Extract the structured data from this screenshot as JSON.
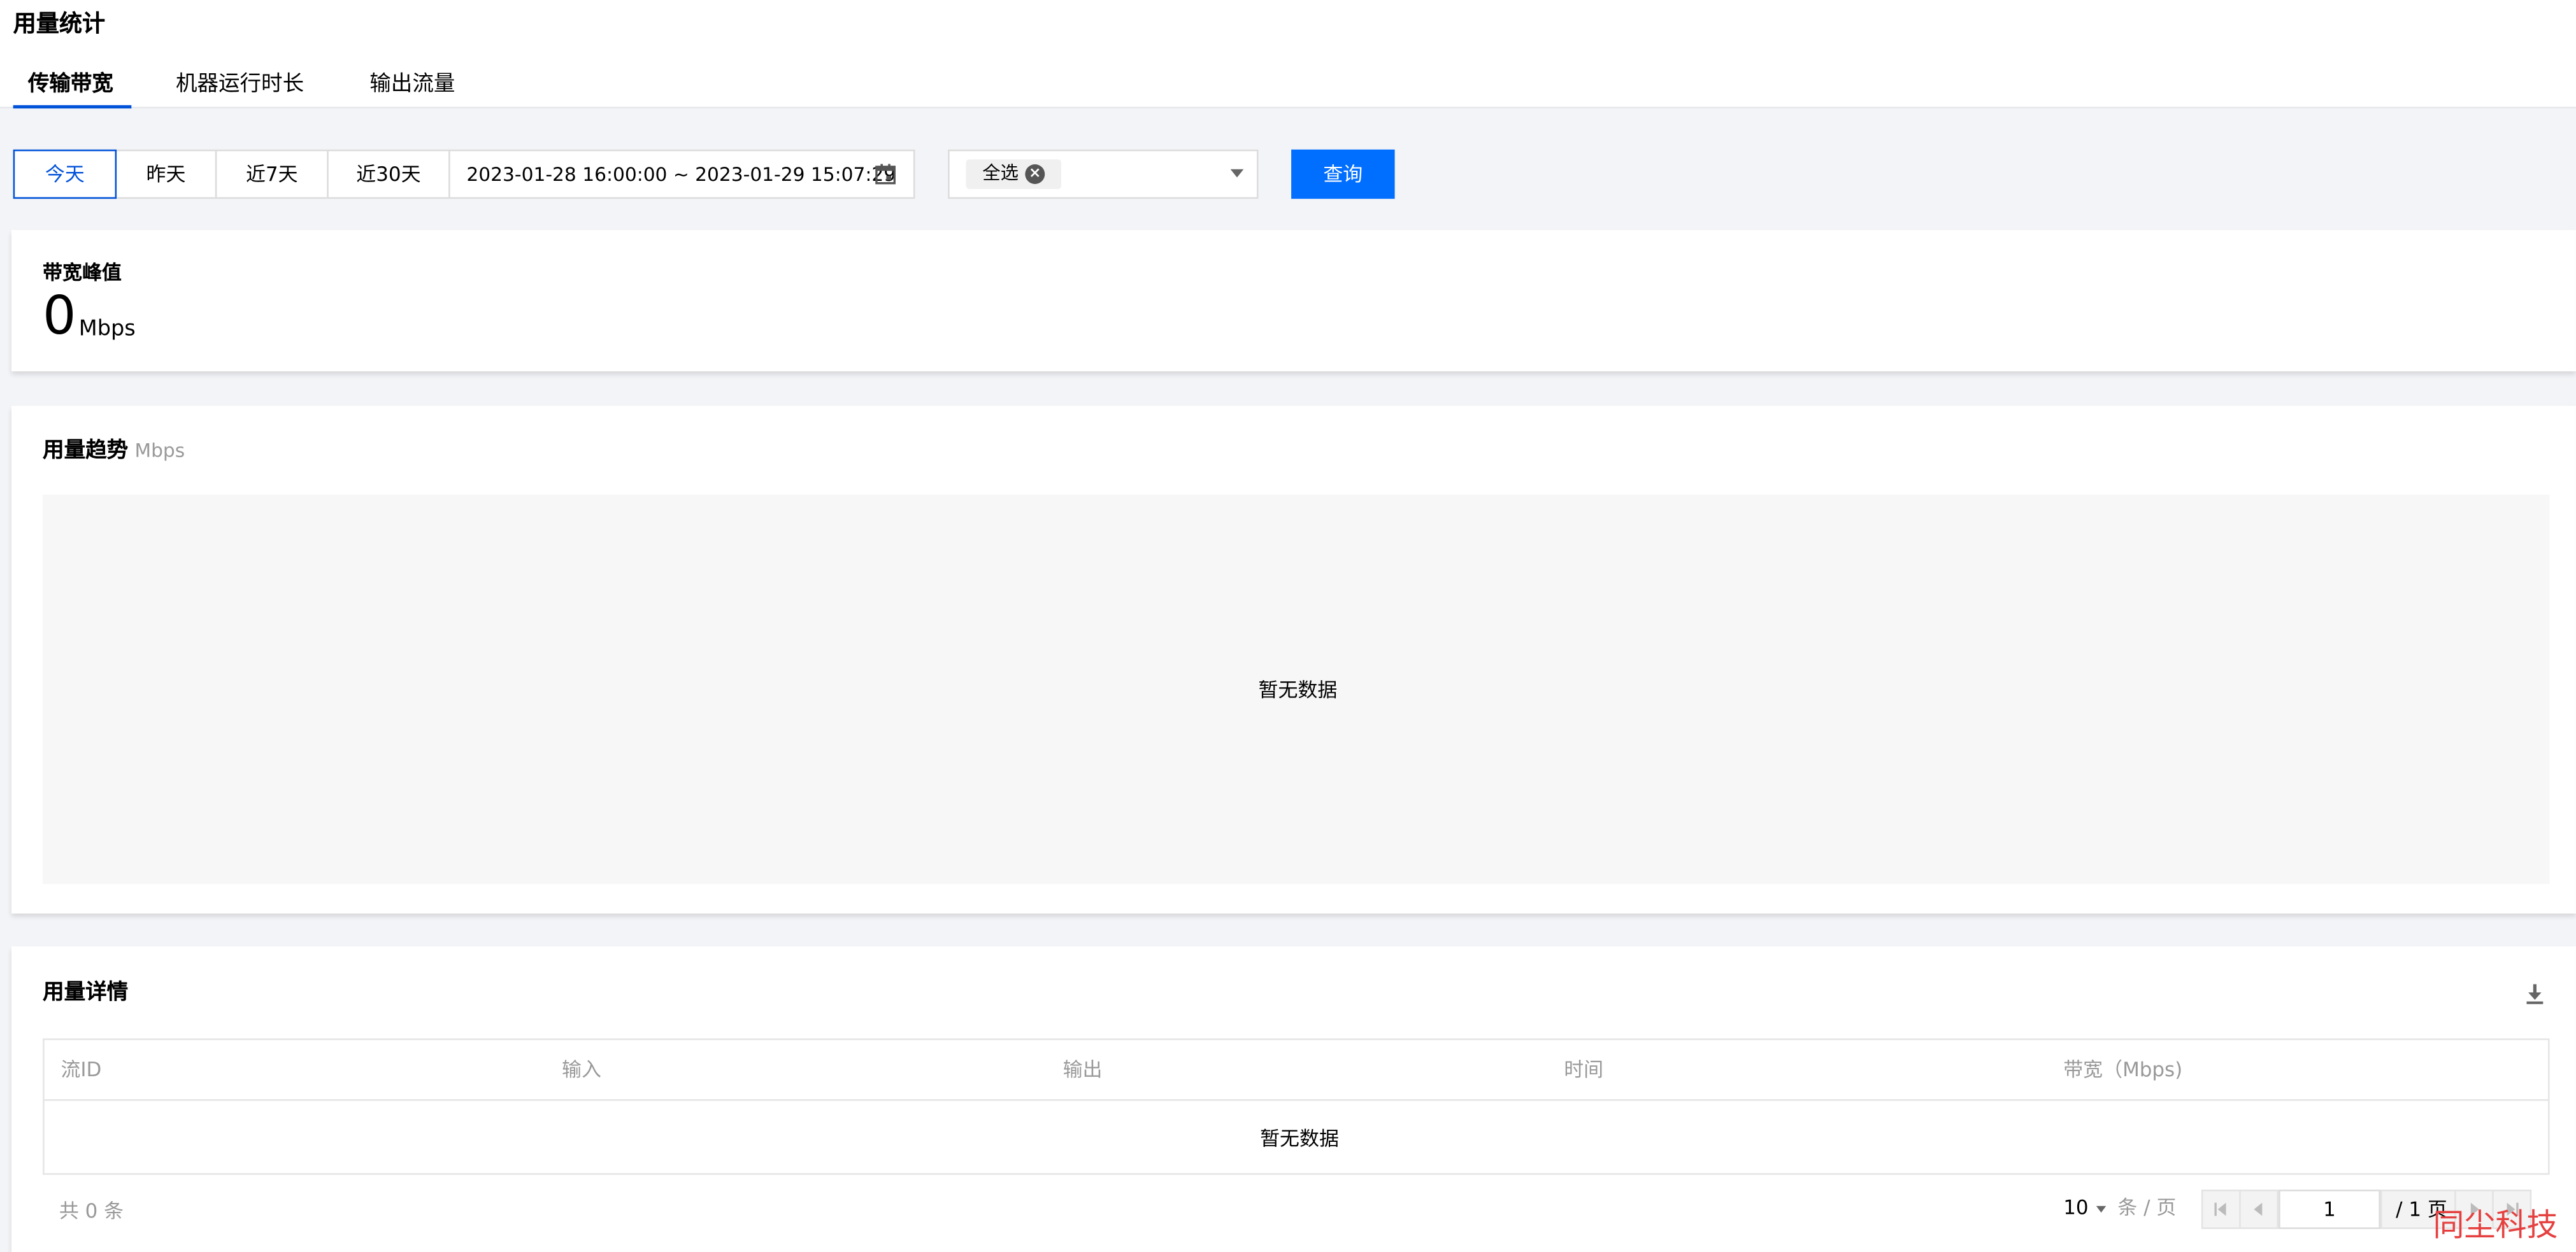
{
  "header": {
    "title": "用量统计",
    "tabs": [
      {
        "label": "传输带宽",
        "active": true
      },
      {
        "label": "机器运行时长",
        "active": false
      },
      {
        "label": "输出流量",
        "active": false
      }
    ]
  },
  "toolbar": {
    "range_buttons": [
      {
        "label": "今天",
        "selected": true
      },
      {
        "label": "昨天",
        "selected": false
      },
      {
        "label": "近7天",
        "selected": false
      },
      {
        "label": "近30天",
        "selected": false
      }
    ],
    "date_range": "2023-01-28 16:00:00   ~ 2023-01-29 15:07:29",
    "select_tag": "全选",
    "query_label": "查询"
  },
  "peak": {
    "title": "带宽峰值",
    "value": "0",
    "unit": "Mbps"
  },
  "trend": {
    "title": "用量趋势",
    "unit": "Mbps",
    "empty": "暂无数据"
  },
  "detail": {
    "title": "用量详情",
    "columns": [
      "流ID",
      "输入",
      "输出",
      "时间",
      "带宽（Mbps)"
    ],
    "empty": "暂无数据",
    "total_text": "共  0  条",
    "page_size": "10",
    "page_unit": "条 / 页",
    "current_page": "1",
    "page_total": "/ 1 页"
  },
  "watermark": "同尘科技",
  "colors": {
    "primary": "#006eff",
    "tab_active": "#0052d9",
    "muted_text": "#999999",
    "page_bg": "#f3f4f7",
    "watermark": "#e5403f"
  }
}
